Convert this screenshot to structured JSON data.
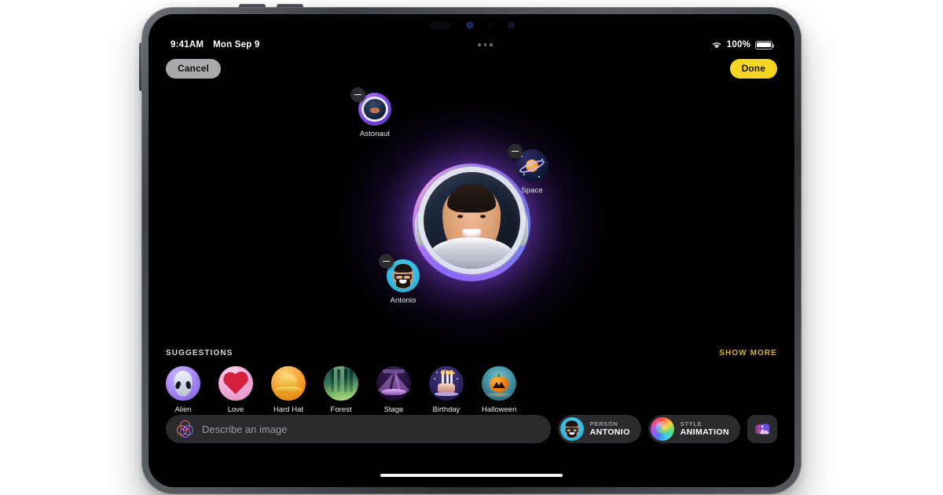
{
  "statusbar": {
    "time": "9:41AM",
    "date": "Mon Sep 9",
    "battery_percent": "100%",
    "wifi_icon": "wifi-icon",
    "battery_icon": "battery-icon",
    "multitask_handle": "three-dots-handle"
  },
  "topnav": {
    "cancel_label": "Cancel",
    "done_label": "Done",
    "done_color": "#f6d622"
  },
  "canvas": {
    "hero_alt": "astronaut-portrait",
    "elements": [
      {
        "label": "Astonaut",
        "icon": "astronaut-helmet-icon",
        "remove_icon": "minus-icon"
      },
      {
        "label": "Space",
        "icon": "saturn-planet-icon",
        "remove_icon": "minus-icon"
      },
      {
        "label": "Antonio",
        "icon": "memoji-avatar-icon",
        "remove_icon": "minus-icon"
      }
    ]
  },
  "suggestions": {
    "title": "SUGGESTIONS",
    "show_more_label": "SHOW MORE",
    "show_more_color": "#d8b22a",
    "items": [
      {
        "label": "Alien",
        "icon": "alien-head-icon"
      },
      {
        "label": "Love",
        "icon": "heart-icon"
      },
      {
        "label": "Hard Hat",
        "icon": "hard-hat-icon"
      },
      {
        "label": "Forest",
        "icon": "forest-icon"
      },
      {
        "label": "Stage",
        "icon": "stage-lights-icon"
      },
      {
        "label": "Birthday",
        "icon": "birthday-cake-icon"
      },
      {
        "label": "Halloween",
        "icon": "jack-o-lantern-icon"
      }
    ]
  },
  "bottombar": {
    "describe_placeholder": "Describe an image",
    "describe_value": "",
    "playground_icon": "image-playground-rings-icon",
    "person": {
      "key": "PERSON",
      "value": "ANTONIO",
      "icon": "memoji-avatar-icon"
    },
    "style": {
      "key": "STYLE",
      "value": "ANIMATION",
      "icon": "color-wheel-icon"
    },
    "photos_button_icon": "photo-library-icon"
  },
  "system": {
    "home_indicator": "home-indicator"
  }
}
